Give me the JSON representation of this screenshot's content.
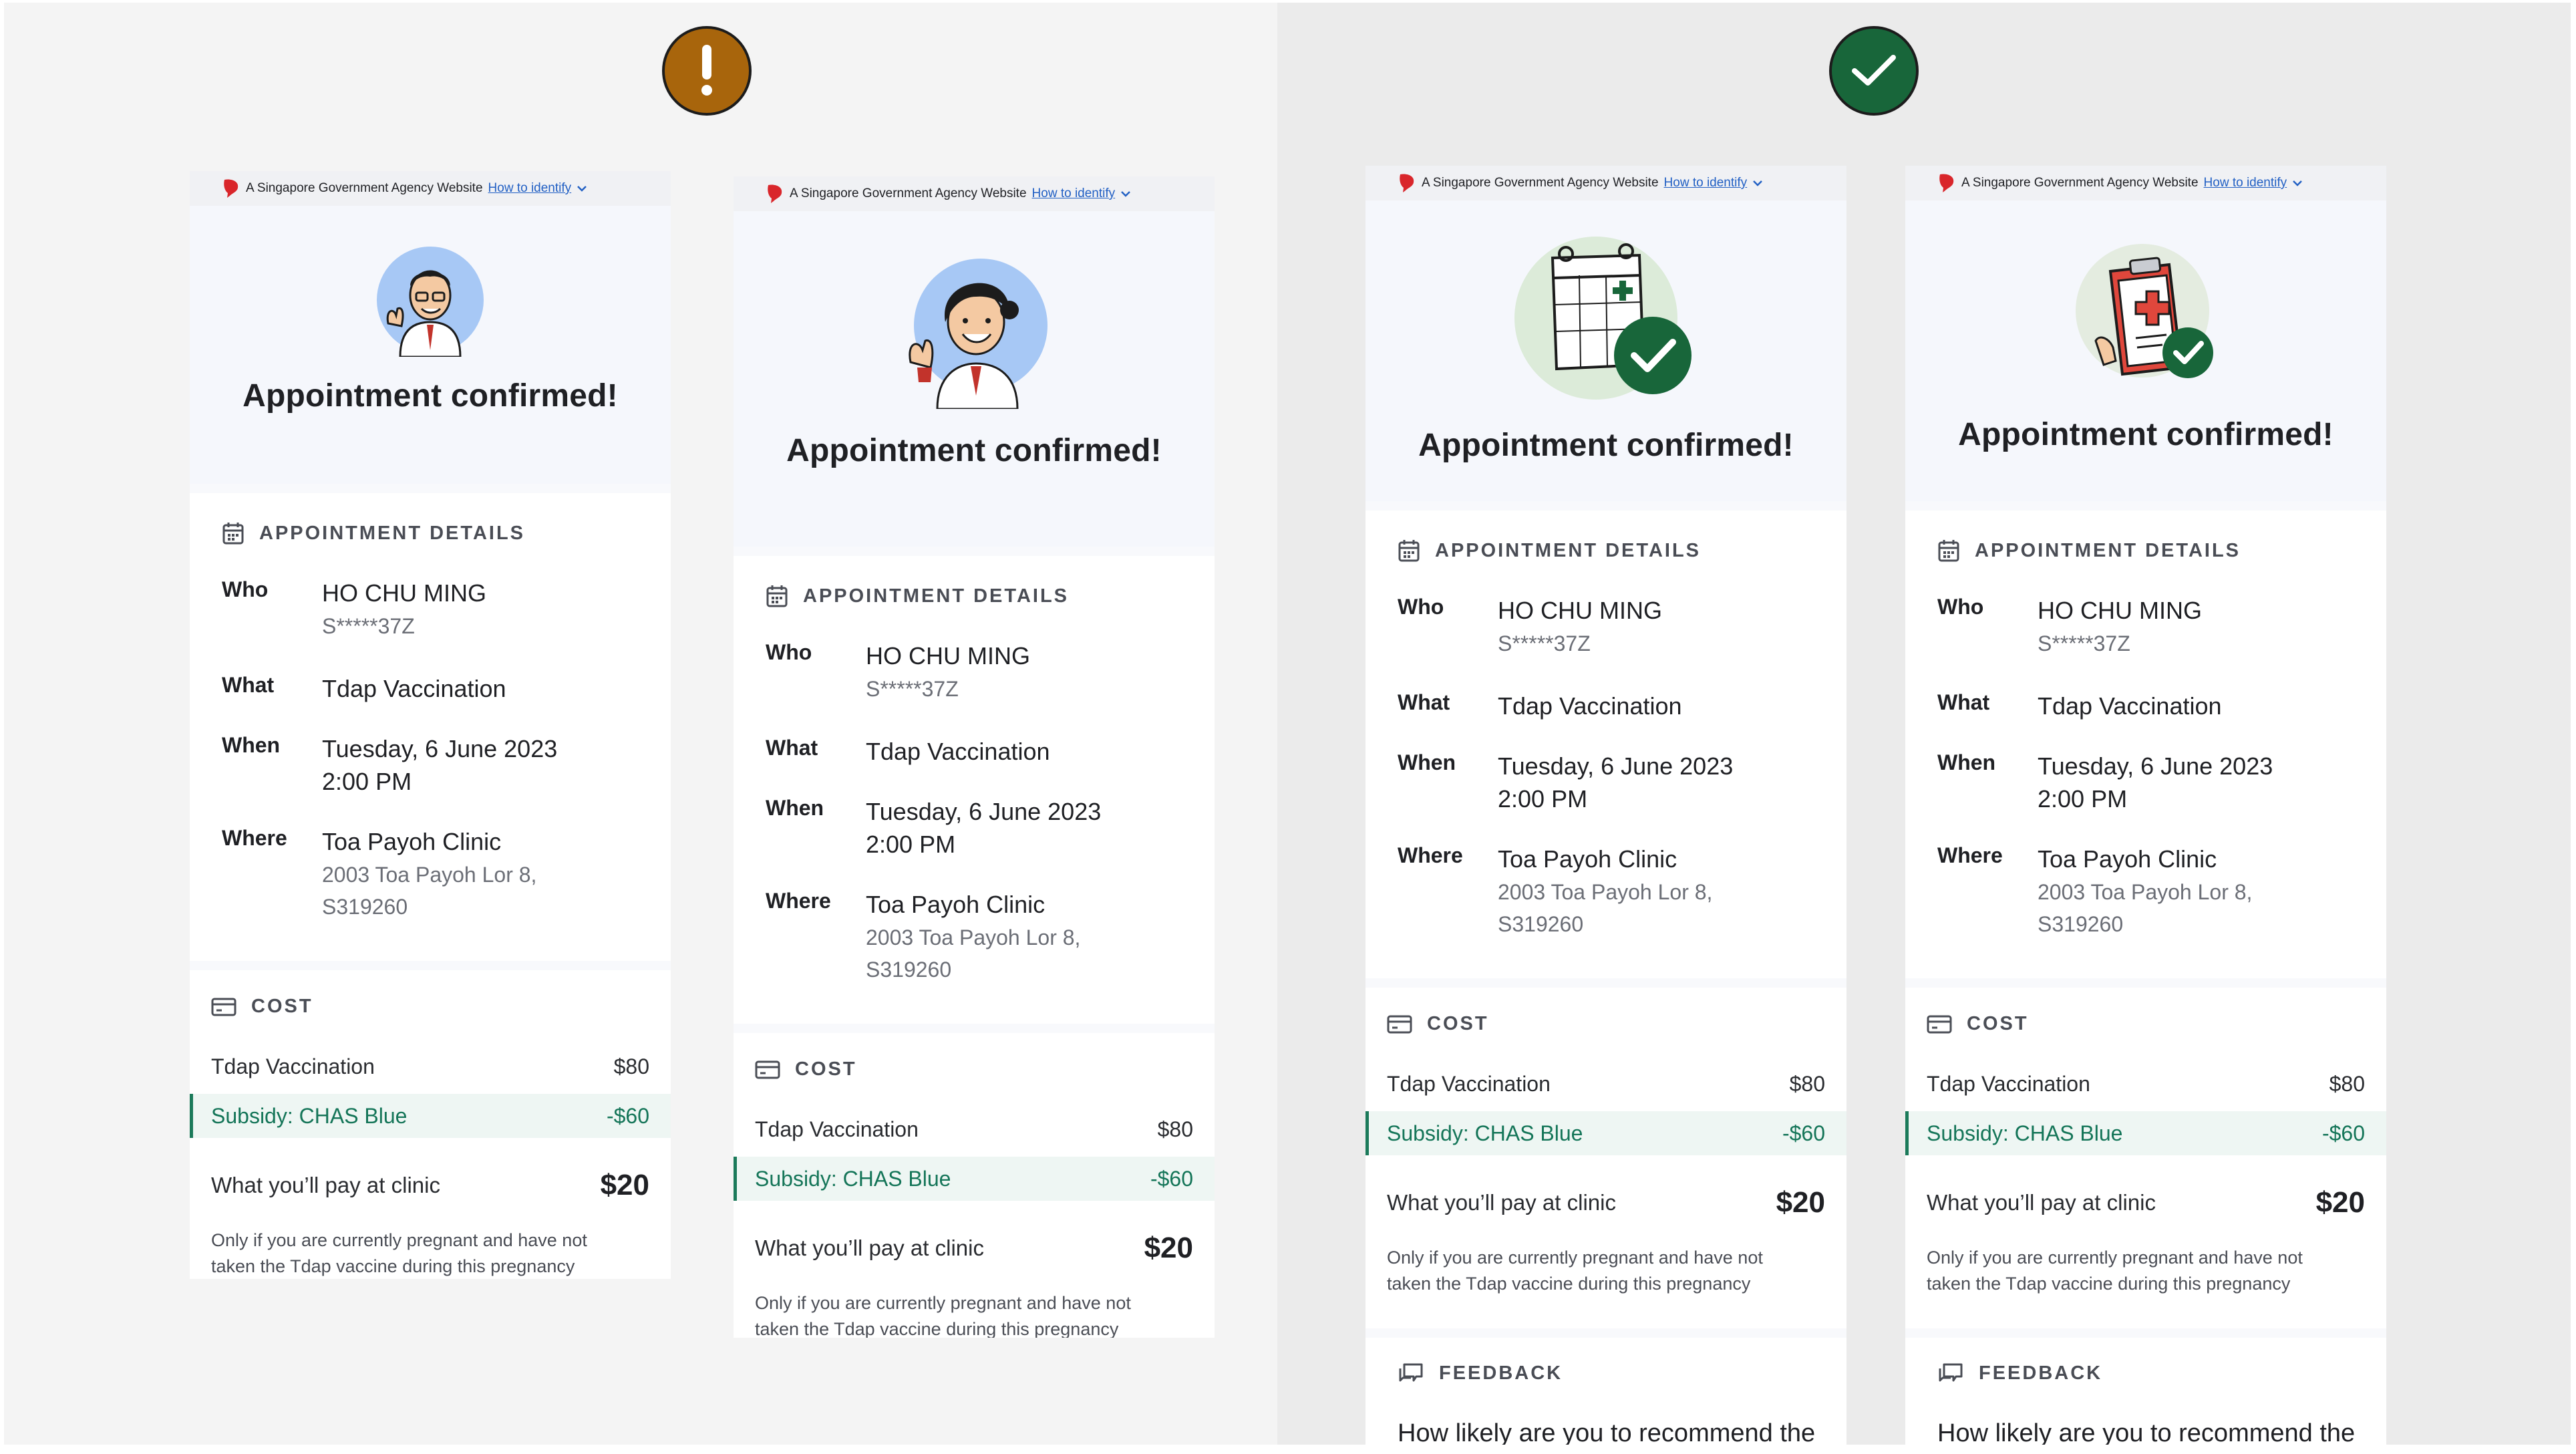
{
  "gov_banner": {
    "text": "A Singapore Government Agency Website",
    "link": "How to identify"
  },
  "status_badges": {
    "warning": "!",
    "success": "✓"
  },
  "colors": {
    "warning": "#a8650c",
    "success": "#18663a",
    "subsidy": "#147558",
    "link": "#2260c4"
  },
  "screens": [
    {
      "illustration": "doctor-avatar-male",
      "title": "Appointment confirmed!",
      "details_header": "APPOINTMENT DETAILS",
      "who_label": "Who",
      "who_name": "HO CHU MING",
      "who_id": "S*****37Z",
      "what_label": "What",
      "what_value": "Tdap Vaccination",
      "when_label": "When",
      "when_date": "Tuesday, 6 June 2023",
      "when_time": "2:00 PM",
      "where_label": "Where",
      "where_name": "Toa Payoh Clinic",
      "where_addr1": "2003 Toa Payoh Lor 8,",
      "where_addr2": "S319260",
      "cost_header": "COST",
      "cost_item": "Tdap Vaccination",
      "cost_amount": "$80",
      "subsidy_label": "Subsidy: CHAS Blue",
      "subsidy_amount": "-$60",
      "total_label": "What you’ll pay at clinic",
      "total_amount": "$20",
      "note1": "Only if you are currently pregnant and have not",
      "note2": "taken the Tdap vaccine during this pregnancy"
    },
    {
      "illustration": "doctor-avatar-female",
      "title": "Appointment confirmed!",
      "details_header": "APPOINTMENT DETAILS",
      "who_label": "Who",
      "who_name": "HO CHU MING",
      "who_id": "S*****37Z",
      "what_label": "What",
      "what_value": "Tdap Vaccination",
      "when_label": "When",
      "when_date": "Tuesday, 6 June 2023",
      "when_time": "2:00 PM",
      "where_label": "Where",
      "where_name": "Toa Payoh Clinic",
      "where_addr1": "2003 Toa Payoh Lor 8,",
      "where_addr2": "S319260",
      "cost_header": "COST",
      "cost_item": "Tdap Vaccination",
      "cost_amount": "$80",
      "subsidy_label": "Subsidy: CHAS Blue",
      "subsidy_amount": "-$60",
      "total_label": "What you’ll pay at clinic",
      "total_amount": "$20",
      "note1": "Only if you are currently pregnant and have not",
      "note2": "taken the Tdap vaccine during this pregnancy"
    },
    {
      "illustration": "calendar-check",
      "title": "Appointment confirmed!",
      "details_header": "APPOINTMENT DETAILS",
      "who_label": "Who",
      "who_name": "HO CHU MING",
      "who_id": "S*****37Z",
      "what_label": "What",
      "what_value": "Tdap Vaccination",
      "when_label": "When",
      "when_date": "Tuesday, 6 June 2023",
      "when_time": "2:00 PM",
      "where_label": "Where",
      "where_name": "Toa Payoh Clinic",
      "where_addr1": "2003 Toa Payoh Lor 8,",
      "where_addr2": "S319260",
      "cost_header": "COST",
      "cost_item": "Tdap Vaccination",
      "cost_amount": "$80",
      "subsidy_label": "Subsidy: CHAS Blue",
      "subsidy_amount": "-$60",
      "total_label": "What you’ll pay at clinic",
      "total_amount": "$20",
      "note1": "Only if you are currently pregnant and have not",
      "note2": "taken the Tdap vaccine during this pregnancy",
      "feedback_header": "FEEDBACK",
      "feedback_question": "How likely are you to recommend the"
    },
    {
      "illustration": "medical-clipboard-check",
      "title": "Appointment confirmed!",
      "details_header": "APPOINTMENT DETAILS",
      "who_label": "Who",
      "who_name": "HO CHU MING",
      "who_id": "S*****37Z",
      "what_label": "What",
      "what_value": "Tdap Vaccination",
      "when_label": "When",
      "when_date": "Tuesday, 6 June 2023",
      "when_time": "2:00 PM",
      "where_label": "Where",
      "where_name": "Toa Payoh Clinic",
      "where_addr1": "2003 Toa Payoh Lor 8,",
      "where_addr2": "S319260",
      "cost_header": "COST",
      "cost_item": "Tdap Vaccination",
      "cost_amount": "$80",
      "subsidy_label": "Subsidy: CHAS Blue",
      "subsidy_amount": "-$60",
      "total_label": "What you’ll pay at clinic",
      "total_amount": "$20",
      "note1": "Only if you are currently pregnant and have not",
      "note2": "taken the Tdap vaccine during this pregnancy",
      "feedback_header": "FEEDBACK",
      "feedback_question": "How likely are you to recommend the"
    }
  ]
}
